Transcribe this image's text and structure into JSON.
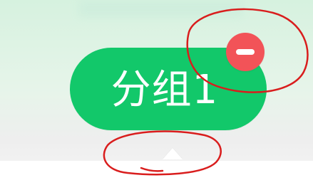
{
  "chip": {
    "label": "分组1",
    "remove_icon": "minus-icon"
  },
  "partial_chips": {
    "left_fragment": "",
    "right_fragment": ""
  },
  "colors": {
    "pill": "#12c86a",
    "remove_badge": "#f25358",
    "annotation": "#d91d1d"
  }
}
